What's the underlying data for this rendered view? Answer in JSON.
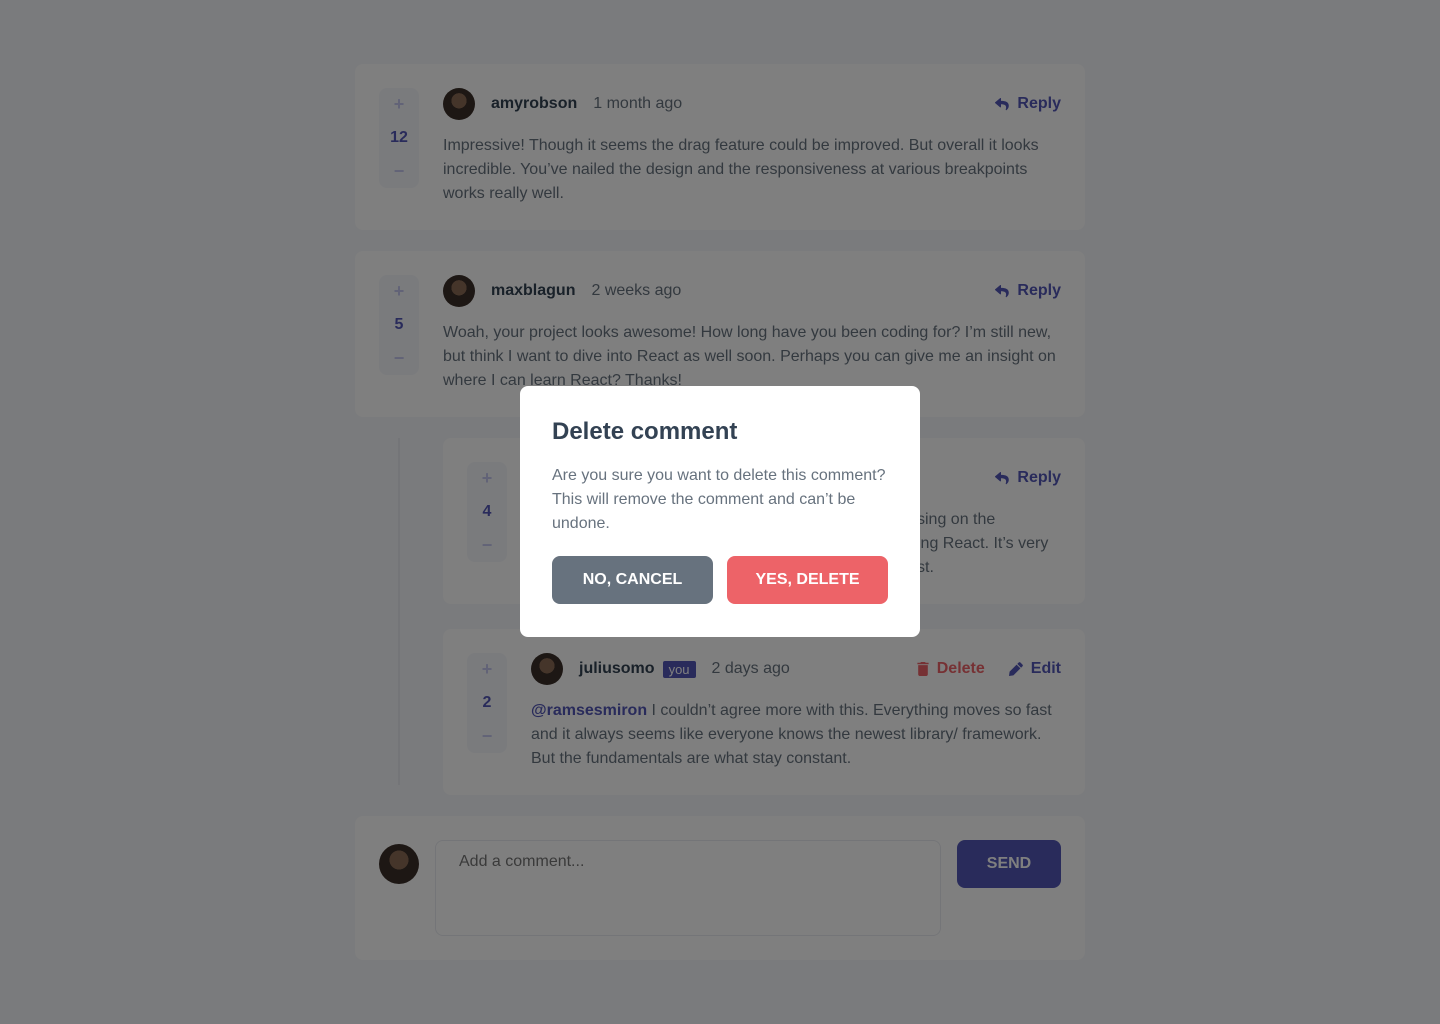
{
  "comments": [
    {
      "user": "amyrobson",
      "time": "1 month ago",
      "score": "12",
      "reply": "Reply",
      "text": "Impressive! Though it seems the drag feature could be improved. But overall it looks incredible. You’ve nailed the design and the responsiveness at various breakpoints works really well."
    },
    {
      "user": "maxblagun",
      "time": "2 weeks ago",
      "score": "5",
      "reply": "Reply",
      "text": "Woah, your project looks awesome! How long have you been coding for? I’m still new, but think I want to dive into React as well soon. Perhaps you can give me an insight on where I can learn React? Thanks!"
    }
  ],
  "replies": [
    {
      "score": "4",
      "reply": "Reply",
      "text_fragments": [
        "sing on the",
        "ing React. It’s very",
        "st."
      ]
    },
    {
      "user": "juliusomo",
      "you": "you",
      "time": "2 days ago",
      "score": "2",
      "delete": "Delete",
      "edit": "Edit",
      "mention": "@ramsesmiron",
      "text": " I couldn’t agree more with this. Everything moves so fast and it always seems like everyone knows the newest library/ framework. But the fundamentals are what stay constant."
    }
  ],
  "add": {
    "placeholder": "Add a comment...",
    "send": "SEND"
  },
  "vote": {
    "plus": "+",
    "minus": "−"
  },
  "modal": {
    "title": "Delete comment",
    "text": "Are you sure you want to delete this comment? This will remove the comment and can’t be undone.",
    "cancel": "NO, CANCEL",
    "confirm": "YES, DELETE"
  },
  "colors": {
    "primary": "#5357b6",
    "danger": "#ed6368",
    "cancel": "#67727e"
  }
}
